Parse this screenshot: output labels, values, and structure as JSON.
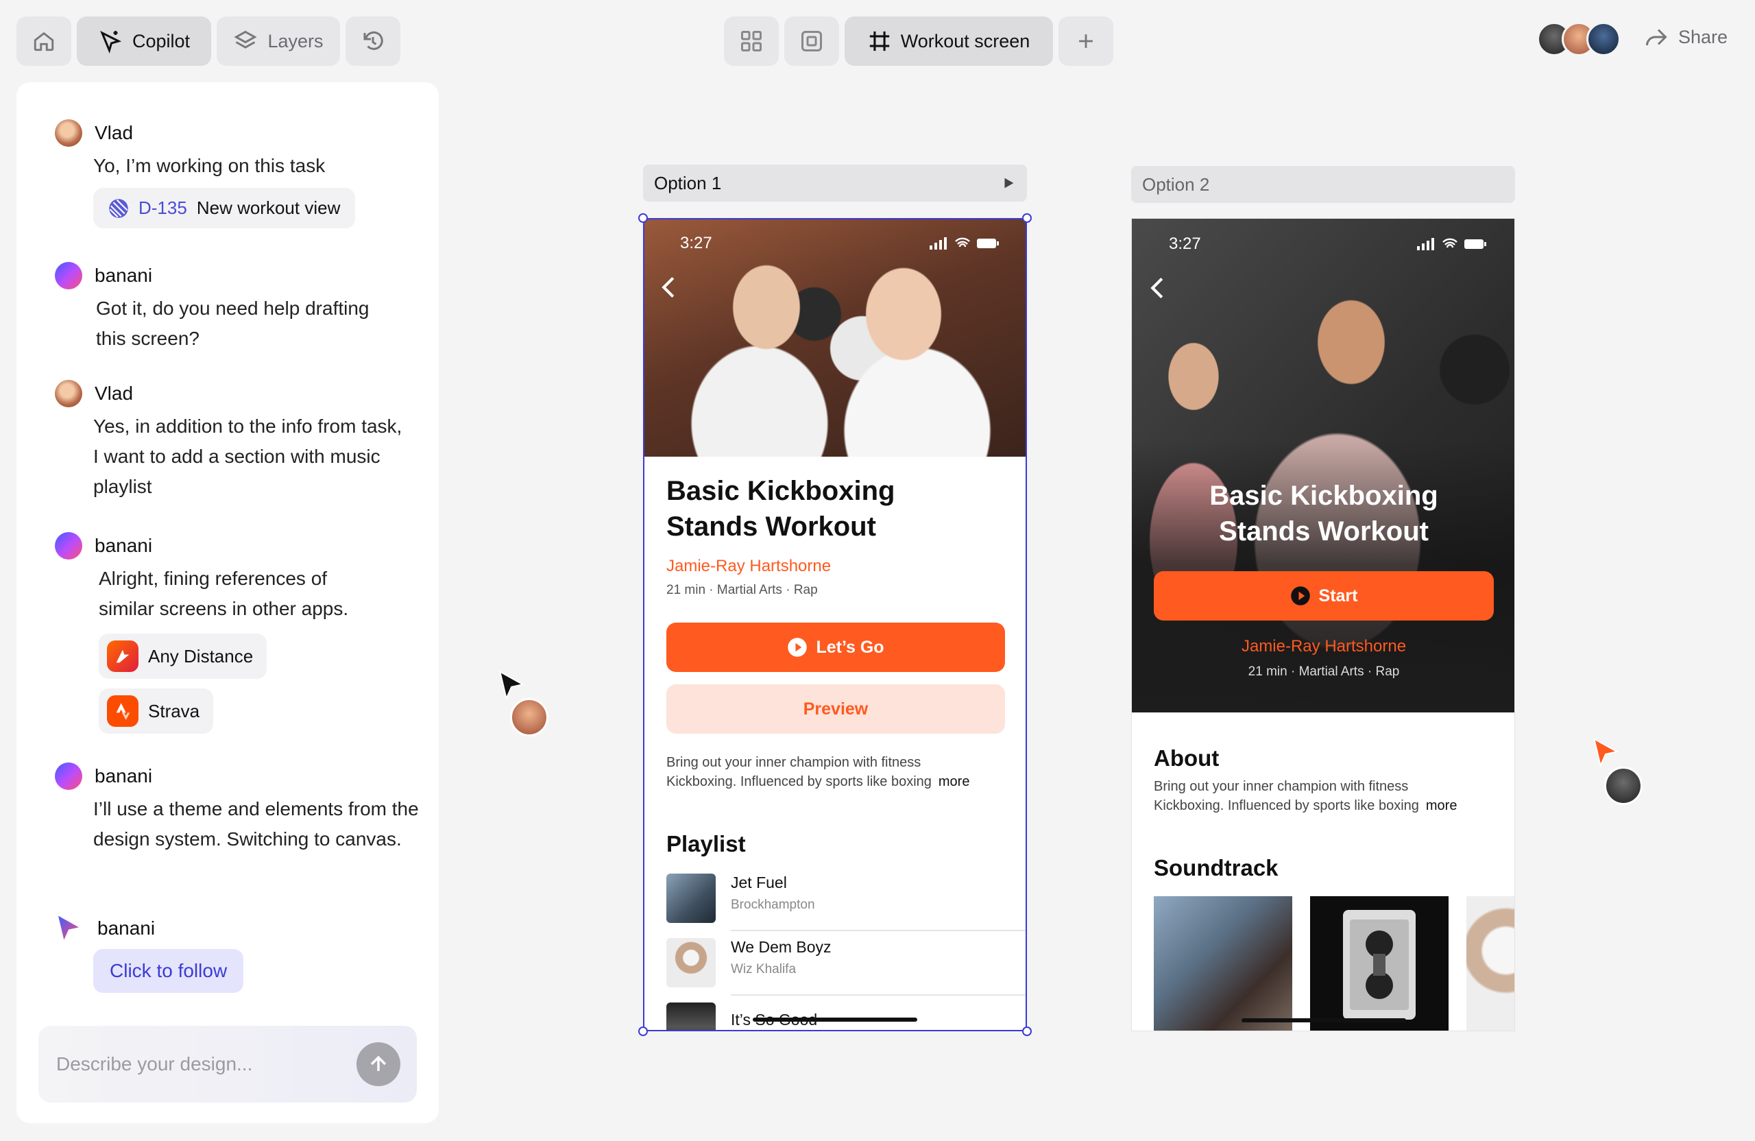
{
  "toolbar": {
    "copilot_label": "Copilot",
    "layers_label": "Layers",
    "screen_label": "Workout screen",
    "share_label": "Share"
  },
  "chat": {
    "messages": [
      {
        "author": "Vlad",
        "text": "Yo, I’m working on this task",
        "task_id": "D-135",
        "task_title": "New workout view"
      },
      {
        "author": "banani",
        "text": "Got it, do you need help drafting this screen?"
      },
      {
        "author": "Vlad",
        "text": "Yes, in addition to the info from task, I want to add a section with music playlist"
      },
      {
        "author": "banani",
        "text": "Alright, fining references of similar screens in other apps.",
        "refs": [
          "Any Distance",
          "Strava"
        ]
      },
      {
        "author": "banani",
        "text": "I’ll use a theme and elements from the design system. Switching to canvas."
      },
      {
        "author": "banani",
        "action": "Click to follow"
      }
    ],
    "input_placeholder": "Describe your design..."
  },
  "option1": {
    "label": "Option 1",
    "time": "3:27",
    "title_line1": "Basic Kickboxing",
    "title_line2": "Stands Workout",
    "author": "Jamie-Ray Hartshorne",
    "meta": "21 min · Martial Arts · Rap",
    "primary_button": "Let’s Go",
    "secondary_button": "Preview",
    "description_line1": "Bring out your inner champion with fitness",
    "description_line2": "Kickboxing. Influenced by sports like boxing",
    "more": "more",
    "playlist_title": "Playlist",
    "tracks": [
      {
        "name": "Jet Fuel",
        "artist": "Brockhampton"
      },
      {
        "name": "We Dem Boyz",
        "artist": "Wiz Khalifa"
      },
      {
        "name": "It’s So Good",
        "artist": ""
      }
    ]
  },
  "option2": {
    "label": "Option 2",
    "time": "3:27",
    "title_line1": "Basic Kickboxing",
    "title_line2": "Stands Workout",
    "start_button": "Start",
    "author": "Jamie-Ray Hartshorne",
    "meta": "21 min · Martial Arts · Rap",
    "about_title": "About",
    "description_line1": "Bring out your inner champion with fitness",
    "description_line2": "Kickboxing. Influenced by sports like boxing",
    "more": "more",
    "soundtrack_title": "Soundtrack"
  },
  "colors": {
    "accent": "#ff5a1f",
    "selection": "#3b3bd6",
    "preview_bg": "#fde3da"
  }
}
